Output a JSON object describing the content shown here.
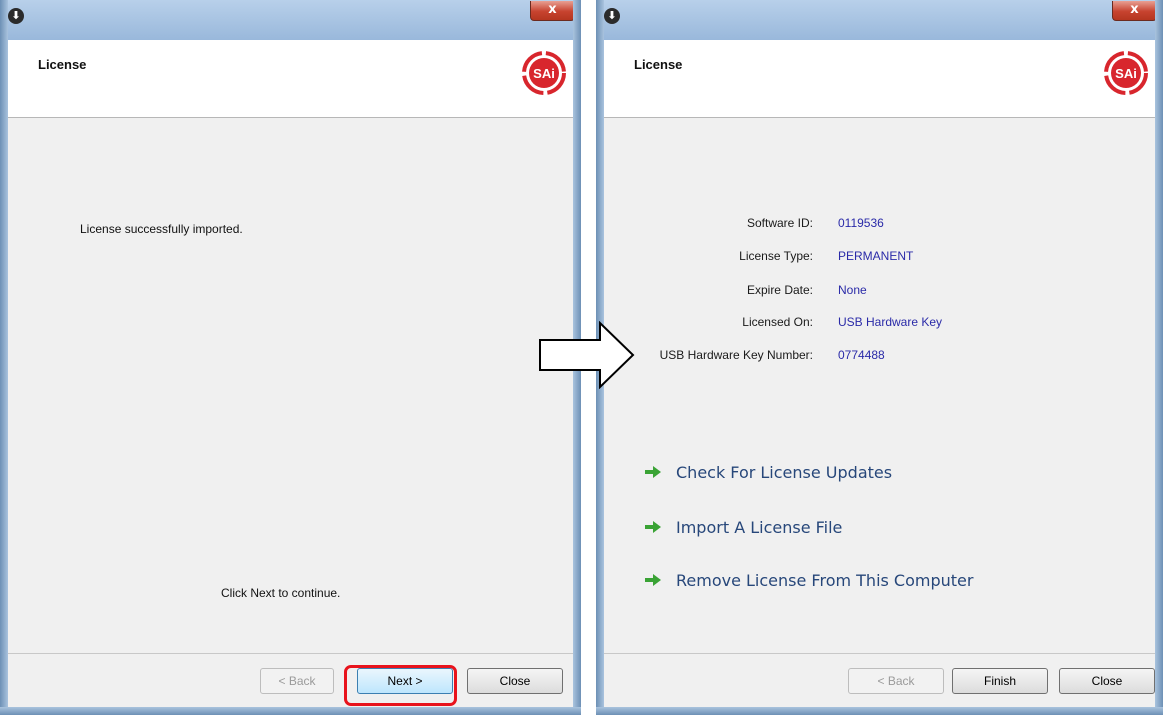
{
  "left_dialog": {
    "icon_glyph": "⬇",
    "close_glyph": "x",
    "header_title": "License",
    "logo_text": "SAi",
    "message_top": "License successfully imported.",
    "message_bottom": "Click Next to continue.",
    "buttons": {
      "back": "< Back",
      "next": "Next >",
      "close": "Close"
    },
    "highlighted_button": "next",
    "highlight_color": "#e8131c"
  },
  "right_dialog": {
    "icon_glyph": "⬇",
    "close_glyph": "x",
    "header_title": "License",
    "logo_text": "SAi",
    "info": [
      {
        "label": "Software ID:",
        "value": "0119536"
      },
      {
        "label": "License Type:",
        "value": "PERMANENT"
      },
      {
        "label": "Expire Date:",
        "value": "None"
      },
      {
        "label": "Licensed On:",
        "value": "USB Hardware Key"
      },
      {
        "label": "USB Hardware Key Number:",
        "value": "0774488"
      }
    ],
    "actions": [
      {
        "label": "Check For License Updates",
        "icon": "green-arrow-icon"
      },
      {
        "label": "Import A License File",
        "icon": "green-arrow-icon"
      },
      {
        "label": "Remove License From This Computer",
        "icon": "green-arrow-icon"
      }
    ],
    "buttons": {
      "back": "< Back",
      "finish": "Finish",
      "close": "Close"
    }
  },
  "flow_arrow_icon": "right-arrow-icon",
  "colors": {
    "logo_red": "#d8262d",
    "link_blue": "#27477a",
    "value_blue": "#2a2aa8",
    "arrow_green": "#3aa335"
  }
}
